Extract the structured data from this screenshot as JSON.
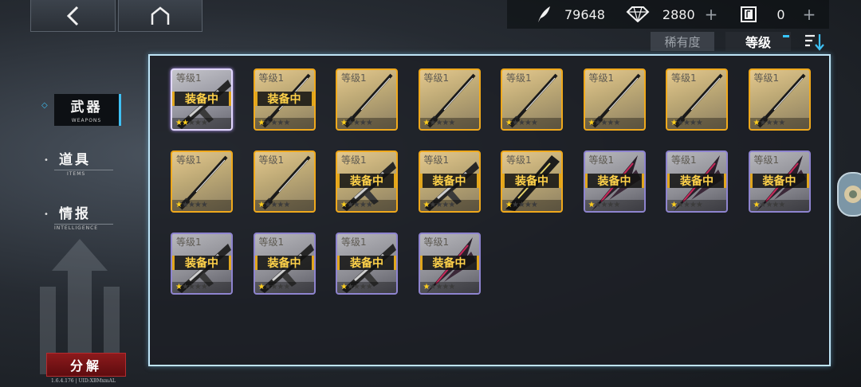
{
  "resources": [
    {
      "icon": "feather-icon",
      "value": "79648",
      "has_plus": false
    },
    {
      "icon": "diamond-icon",
      "value": "2880",
      "has_plus": true
    },
    {
      "icon": "ticket-icon",
      "value": "0",
      "has_plus": true
    }
  ],
  "plus_symbol": "+",
  "sort": {
    "rarity": "稀有度",
    "level": "等级"
  },
  "sidebar": [
    {
      "label": "武器",
      "sub": "WEAPONS",
      "active": true
    },
    {
      "label": "道具",
      "sub": "ITEMS",
      "active": false
    },
    {
      "label": "情报",
      "sub": "INTELLIGENCE",
      "active": false
    }
  ],
  "dismantle_label": "分解",
  "version_text": "1.6.4.176 | UID:XBMxmAL",
  "equip_label": "装备中",
  "star_symbol": "★",
  "cards": [
    {
      "level": "等级1",
      "equipped": true,
      "stars": 2,
      "rarity": "glow",
      "weapon": "gun"
    },
    {
      "level": "等级1",
      "equipped": true,
      "stars": 1,
      "rarity": "gold",
      "weapon": "katana"
    },
    {
      "level": "等级1",
      "equipped": false,
      "stars": 1,
      "rarity": "gold",
      "weapon": "katana"
    },
    {
      "level": "等级1",
      "equipped": false,
      "stars": 1,
      "rarity": "gold",
      "weapon": "katana"
    },
    {
      "level": "等级1",
      "equipped": false,
      "stars": 1,
      "rarity": "gold",
      "weapon": "katana"
    },
    {
      "level": "等级1",
      "equipped": false,
      "stars": 1,
      "rarity": "gold",
      "weapon": "katana"
    },
    {
      "level": "等级1",
      "equipped": false,
      "stars": 1,
      "rarity": "gold",
      "weapon": "katana"
    },
    {
      "level": "等级1",
      "equipped": false,
      "stars": 1,
      "rarity": "gold",
      "weapon": "katana"
    },
    {
      "level": "等级1",
      "equipped": false,
      "stars": 1,
      "rarity": "gold",
      "weapon": "katana"
    },
    {
      "level": "等级1",
      "equipped": false,
      "stars": 1,
      "rarity": "gold",
      "weapon": "katana"
    },
    {
      "level": "等级1",
      "equipped": true,
      "stars": 1,
      "rarity": "gold",
      "weapon": "gun"
    },
    {
      "level": "等级1",
      "equipped": true,
      "stars": 1,
      "rarity": "gold",
      "weapon": "gun"
    },
    {
      "level": "等级1",
      "equipped": true,
      "stars": 1,
      "rarity": "gold",
      "weapon": "blade"
    },
    {
      "level": "等级1",
      "equipped": true,
      "stars": 1,
      "rarity": "purple",
      "weapon": "spike"
    },
    {
      "level": "等级1",
      "equipped": true,
      "stars": 1,
      "rarity": "purple",
      "weapon": "spike"
    },
    {
      "level": "等级1",
      "equipped": true,
      "stars": 1,
      "rarity": "purple",
      "weapon": "spike"
    },
    {
      "level": "等级1",
      "equipped": true,
      "stars": 1,
      "rarity": "purple",
      "weapon": "gun"
    },
    {
      "level": "等级1",
      "equipped": true,
      "stars": 1,
      "rarity": "purple",
      "weapon": "gun"
    },
    {
      "level": "等级1",
      "equipped": true,
      "stars": 1,
      "rarity": "purple",
      "weapon": "gun"
    },
    {
      "level": "等级1",
      "equipped": true,
      "stars": 1,
      "rarity": "purple",
      "weapon": "spike"
    }
  ],
  "colors": {
    "accent": "#3fc0f4",
    "gold_border": "#f0a91c",
    "purple_border": "#8e84cf",
    "equip_text": "#ffd24a",
    "dismantle": "#8c1a1c"
  }
}
